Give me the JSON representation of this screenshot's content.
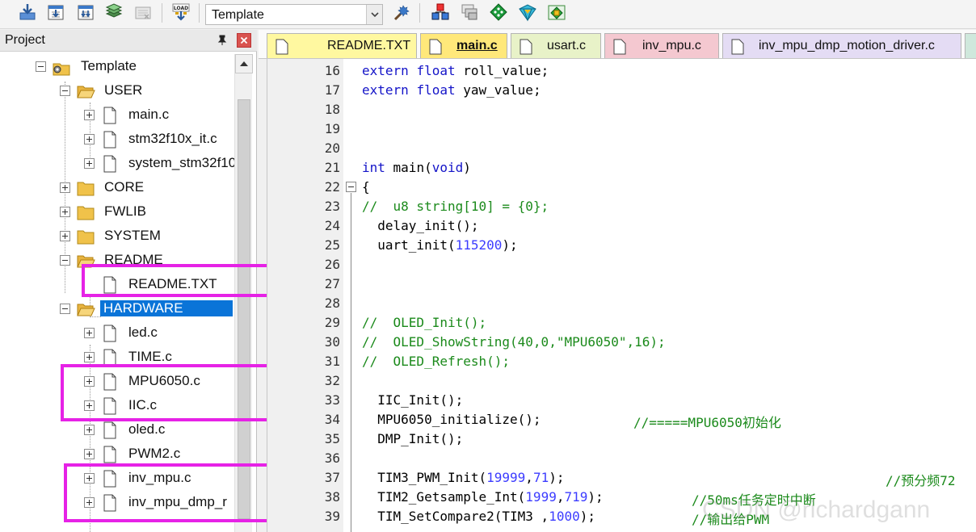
{
  "toolbar": {
    "target_selected": "Template",
    "buttons": [
      "save-icon",
      "build-icon",
      "rebuild-icon",
      "batch-build-icon",
      "stop-build-icon",
      "download-icon",
      "target-options-icon",
      "manage-components-icon",
      "file-extensions-icon",
      "select-packs-icon",
      "pack-installer-icon",
      "run-time-env-icon"
    ]
  },
  "project": {
    "title": "Project",
    "tree": [
      {
        "label": "Template"
      },
      {
        "label": "USER"
      },
      {
        "label": "main.c"
      },
      {
        "label": "stm32f10x_it.c"
      },
      {
        "label": "system_stm32f10"
      },
      {
        "label": "CORE"
      },
      {
        "label": "FWLIB"
      },
      {
        "label": "SYSTEM"
      },
      {
        "label": "README"
      },
      {
        "label": "README.TXT"
      },
      {
        "label": "HARDWARE"
      },
      {
        "label": "led.c"
      },
      {
        "label": "TIME.c"
      },
      {
        "label": "MPU6050.c"
      },
      {
        "label": "IIC.c"
      },
      {
        "label": "oled.c"
      },
      {
        "label": "PWM2.c"
      },
      {
        "label": "inv_mpu.c"
      },
      {
        "label": "inv_mpu_dmp_r"
      }
    ]
  },
  "tabs": [
    {
      "label": "README.TXT",
      "color": "#fff8a0"
    },
    {
      "label": "main.c",
      "color": "#ffe87a",
      "active": true
    },
    {
      "label": "usart.c",
      "color": "#e8f2c8"
    },
    {
      "label": "inv_mpu.c",
      "color": "#f4c8d0"
    },
    {
      "label": "inv_mpu_dmp_motion_driver.c",
      "color": "#e4dcf4"
    }
  ],
  "editor": {
    "line_numbers": [
      "16",
      "17",
      "18",
      "19",
      "20",
      "21",
      "22",
      "23",
      "24",
      "25",
      "26",
      "27",
      "28",
      "29",
      "30",
      "31",
      "32",
      "33",
      "34",
      "35",
      "36",
      "37",
      "38",
      "39"
    ],
    "lines": {
      "l16": {
        "kw1": "extern",
        "kw2": "float",
        "rest": " roll_value;"
      },
      "l17": {
        "kw1": "extern",
        "kw2": "float",
        "rest": " yaw_value;"
      },
      "l21": {
        "kw1": "int",
        "mid": " main(",
        "kw2": "void",
        "end": ")"
      },
      "l22": "{",
      "l23": "//  u8 string[10] = {0};",
      "l24": "  delay_init();",
      "l25": {
        "pre": "  uart_init(",
        "num": "115200",
        "end": ");"
      },
      "l29": "//  OLED_Init();",
      "l30": "//  OLED_ShowString(40,0,\"MPU6050\",16);",
      "l31": "//  OLED_Refresh();",
      "l33": "  IIC_Init();",
      "l34": {
        "code": "  MPU6050_initialize();",
        "comment": "//=====MPU6050初始化"
      },
      "l35": "  DMP_Init();",
      "l37": {
        "pre": "  TIM3_PWM_Init(",
        "n1": "19999",
        "sep": ",",
        "n2": "71",
        "end": ");",
        "comment": "//预分频72"
      },
      "l38": {
        "pre": "  TIM2_Getsample_Int(",
        "n1": "1999",
        "sep": ",",
        "n2": "719",
        "end": ");",
        "comment": "//50ms任务定时中断"
      },
      "l39": {
        "pre": "  TIM_SetCompare2(TIM3 ,",
        "n1": "1000",
        "end": ");",
        "comment": "//输出给PWM"
      }
    },
    "watermark": "CSDN @richardgann"
  }
}
